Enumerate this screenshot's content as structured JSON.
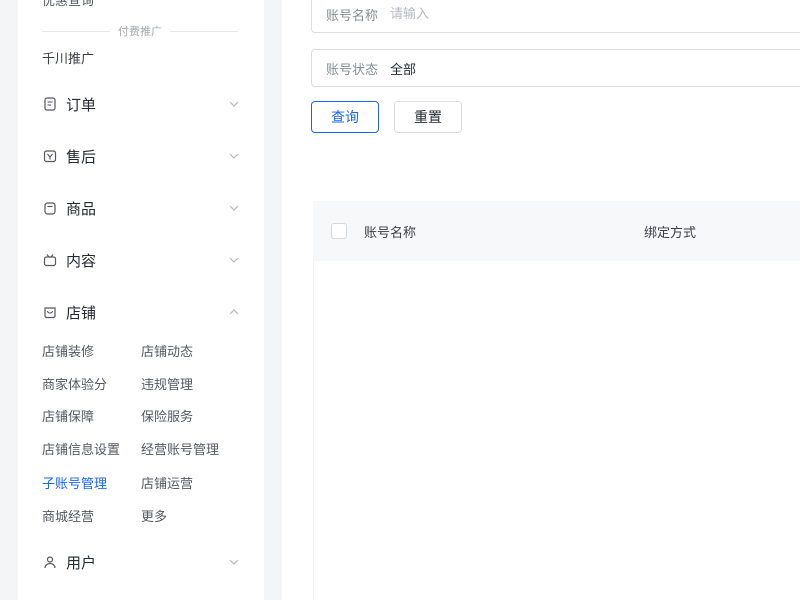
{
  "sidebar": {
    "cut_text": "优惠查询",
    "divider_label": "付费推广",
    "plain_item": "千川推广",
    "menus": [
      {
        "label": "订单",
        "icon": "order-icon",
        "expanded": false
      },
      {
        "label": "售后",
        "icon": "aftersale-icon",
        "expanded": false
      },
      {
        "label": "商品",
        "icon": "product-icon",
        "expanded": false
      },
      {
        "label": "内容",
        "icon": "content-icon",
        "expanded": false
      },
      {
        "label": "店铺",
        "icon": "shop-icon",
        "expanded": true
      },
      {
        "label": "用户",
        "icon": "user-icon",
        "expanded": false
      }
    ],
    "shop_sub": [
      {
        "label": "店铺装修"
      },
      {
        "label": "店铺动态"
      },
      {
        "label": "商家体验分"
      },
      {
        "label": "违规管理"
      },
      {
        "label": "店铺保障"
      },
      {
        "label": "保险服务"
      },
      {
        "label": "店铺信息设置"
      },
      {
        "label": "经营账号管理"
      },
      {
        "label": "子账号管理",
        "active": true
      },
      {
        "label": "店铺运营"
      },
      {
        "label": "商城经营"
      },
      {
        "label": "更多"
      }
    ]
  },
  "filters": {
    "account_name": {
      "label": "账号名称",
      "placeholder": "请输入"
    },
    "account_status": {
      "label": "账号状态",
      "value": "全部"
    }
  },
  "buttons": {
    "query": "查询",
    "reset": "重置"
  },
  "table": {
    "columns": [
      "账号名称",
      "绑定方式"
    ]
  },
  "colors": {
    "accent": "#1966ff",
    "text": "#252931",
    "border": "#dcdee3"
  }
}
